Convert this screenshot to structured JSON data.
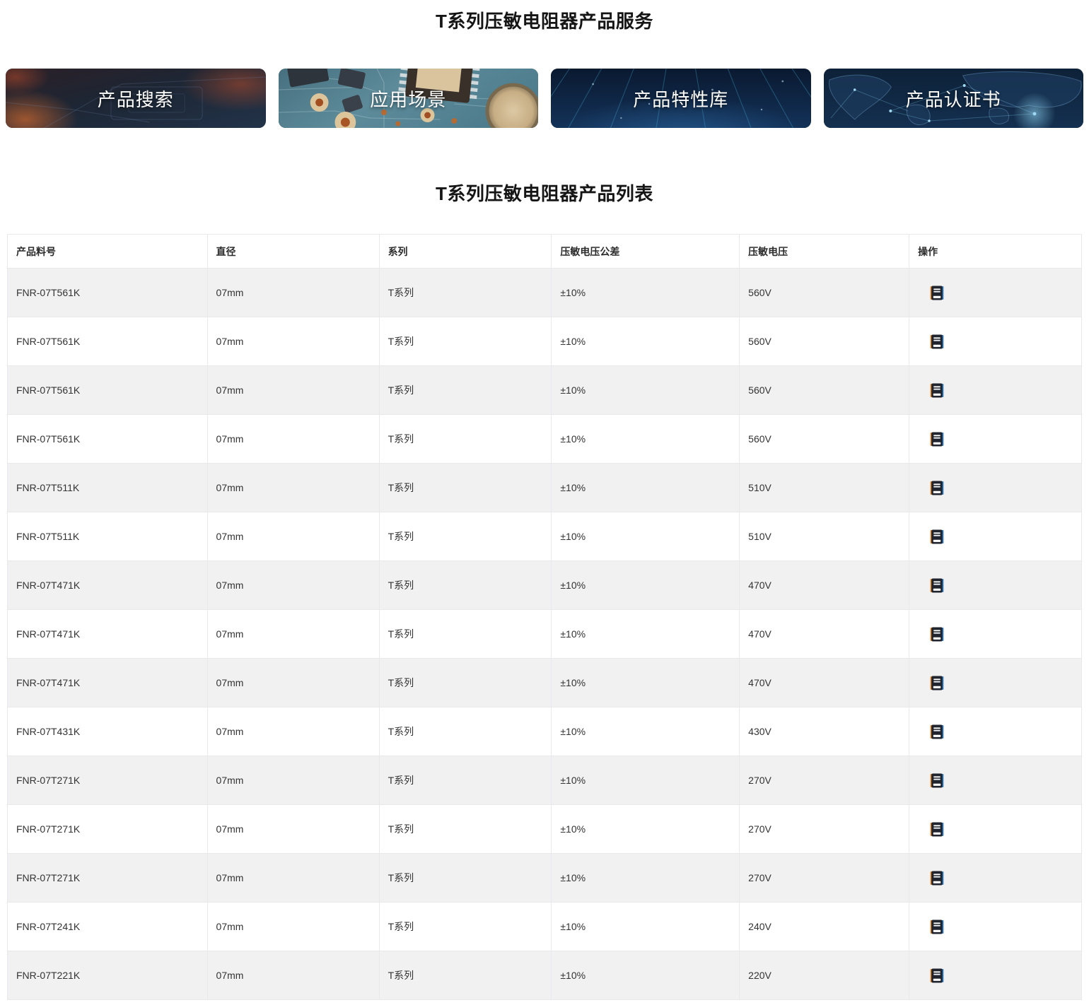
{
  "page": {
    "title": "T系列压敏电阻器产品服务",
    "table_title": "T系列压敏电阻器产品列表"
  },
  "banners": [
    {
      "label": "产品搜索",
      "image": "dark-circuit-board-photo"
    },
    {
      "label": "应用场景",
      "image": "teal-pcb-components-photo"
    },
    {
      "label": "产品特性库",
      "image": "blue-data-rays-photo"
    },
    {
      "label": "产品认证书",
      "image": "world-map-network-photo"
    }
  ],
  "table": {
    "columns": [
      "产品料号",
      "直径",
      "系列",
      "压敏电压公差",
      "压敏电压",
      "操作"
    ],
    "action_icon": "datasheet-document-icon",
    "rows": [
      {
        "part": "FNR-07T561K",
        "diameter": "07mm",
        "series": "T系列",
        "tolerance": "±10%",
        "voltage": "560V"
      },
      {
        "part": "FNR-07T561K",
        "diameter": "07mm",
        "series": "T系列",
        "tolerance": "±10%",
        "voltage": "560V"
      },
      {
        "part": "FNR-07T561K",
        "diameter": "07mm",
        "series": "T系列",
        "tolerance": "±10%",
        "voltage": "560V"
      },
      {
        "part": "FNR-07T561K",
        "diameter": "07mm",
        "series": "T系列",
        "tolerance": "±10%",
        "voltage": "560V"
      },
      {
        "part": "FNR-07T511K",
        "diameter": "07mm",
        "series": "T系列",
        "tolerance": "±10%",
        "voltage": "510V"
      },
      {
        "part": "FNR-07T511K",
        "diameter": "07mm",
        "series": "T系列",
        "tolerance": "±10%",
        "voltage": "510V"
      },
      {
        "part": "FNR-07T471K",
        "diameter": "07mm",
        "series": "T系列",
        "tolerance": "±10%",
        "voltage": "470V"
      },
      {
        "part": "FNR-07T471K",
        "diameter": "07mm",
        "series": "T系列",
        "tolerance": "±10%",
        "voltage": "470V"
      },
      {
        "part": "FNR-07T471K",
        "diameter": "07mm",
        "series": "T系列",
        "tolerance": "±10%",
        "voltage": "470V"
      },
      {
        "part": "FNR-07T431K",
        "diameter": "07mm",
        "series": "T系列",
        "tolerance": "±10%",
        "voltage": "430V"
      },
      {
        "part": "FNR-07T271K",
        "diameter": "07mm",
        "series": "T系列",
        "tolerance": "±10%",
        "voltage": "270V"
      },
      {
        "part": "FNR-07T271K",
        "diameter": "07mm",
        "series": "T系列",
        "tolerance": "±10%",
        "voltage": "270V"
      },
      {
        "part": "FNR-07T271K",
        "diameter": "07mm",
        "series": "T系列",
        "tolerance": "±10%",
        "voltage": "270V"
      },
      {
        "part": "FNR-07T241K",
        "diameter": "07mm",
        "series": "T系列",
        "tolerance": "±10%",
        "voltage": "240V"
      },
      {
        "part": "FNR-07T221K",
        "diameter": "07mm",
        "series": "T系列",
        "tolerance": "±10%",
        "voltage": "220V"
      }
    ]
  },
  "colors": {
    "row_alt": "#f1f1f2",
    "border": "#e9e9eb",
    "icon_dark": "#20242e",
    "icon_orange": "#e08a2d",
    "icon_blue": "#3d8fd6"
  }
}
